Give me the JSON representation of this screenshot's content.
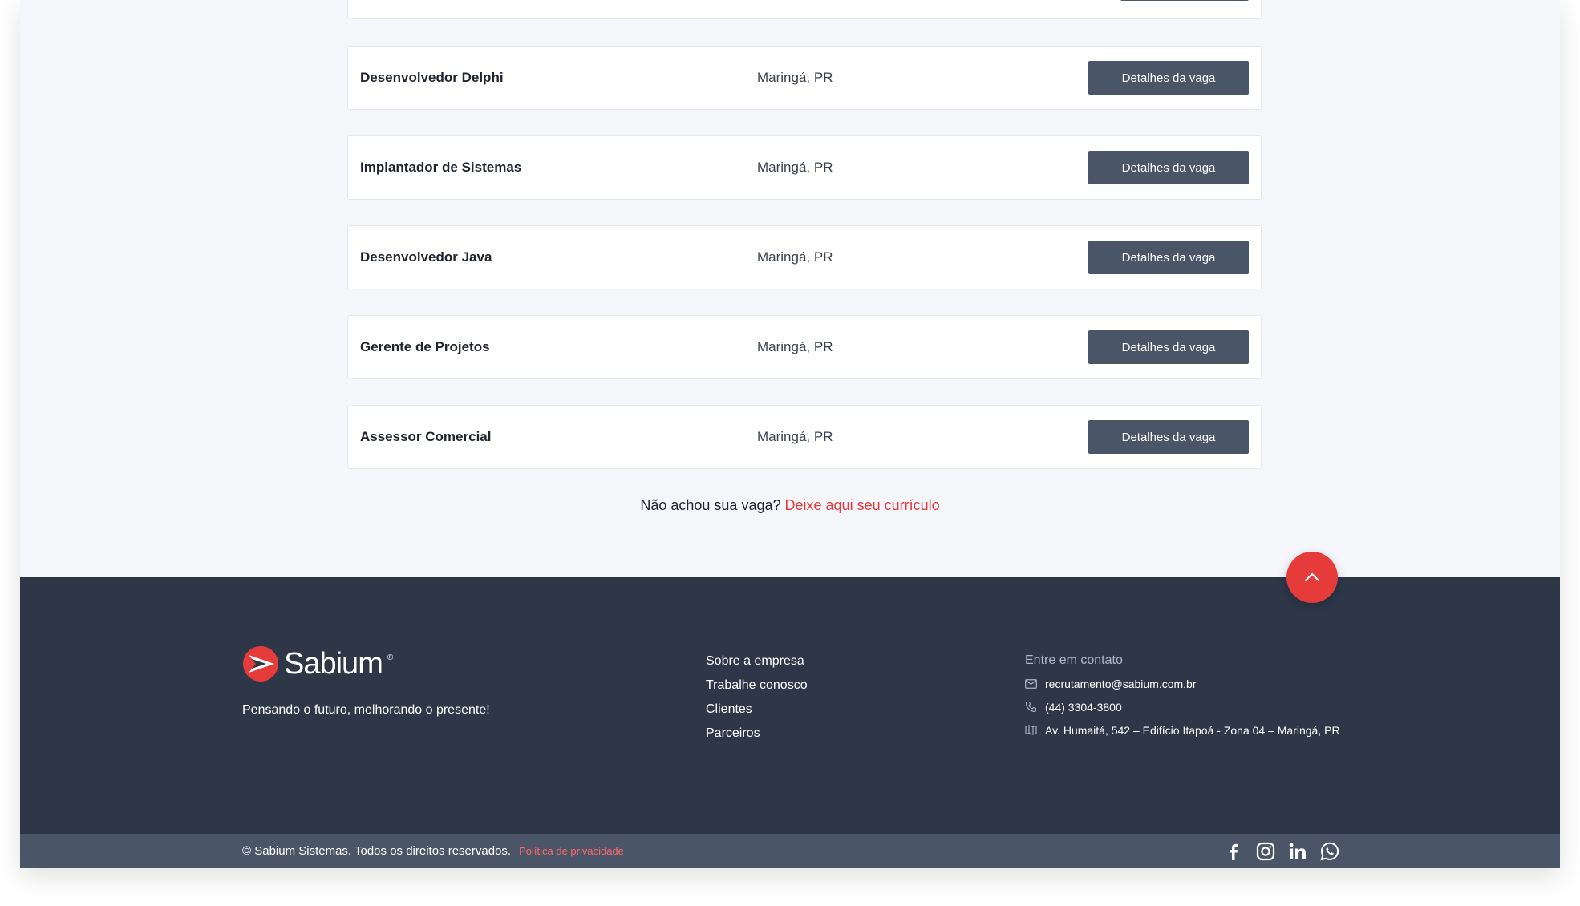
{
  "jobs": [
    {
      "title": "",
      "location": "",
      "button": ""
    },
    {
      "title": "Desenvolvedor Delphi",
      "location": "Maringá, PR",
      "button": "Detalhes da vaga"
    },
    {
      "title": "Implantador de Sistemas",
      "location": "Maringá, PR",
      "button": "Detalhes da vaga"
    },
    {
      "title": "Desenvolvedor Java",
      "location": "Maringá, PR",
      "button": "Detalhes da vaga"
    },
    {
      "title": "Gerente de Projetos",
      "location": "Maringá, PR",
      "button": "Detalhes da vaga"
    },
    {
      "title": "Assessor Comercial",
      "location": "Maringá, PR",
      "button": "Detalhes da vaga"
    }
  ],
  "cv_prompt": {
    "question": "Não achou sua vaga?",
    "link": "Deixe aqui seu currículo"
  },
  "footer": {
    "logo_text": "Sabium",
    "logo_mark": "®",
    "tagline": "Pensando o futuro, melhorando o presente!",
    "links": [
      "Sobre a empresa",
      "Trabalhe conosco",
      "Clientes",
      "Parceiros"
    ],
    "contact": {
      "title": "Entre em contato",
      "email": "recrutamento@sabium.com.br",
      "phone": "(44) 3304-3800",
      "address": "Av. Humaitá, 542 – Edifício Itapoá - Zona 04 – Maringá, PR"
    },
    "copyright": "© Sabium Sistemas. Todos os direitos reservados.",
    "privacy": "Política de privacidade",
    "social": [
      "facebook-icon",
      "instagram-icon",
      "linkedin-icon",
      "whatsapp-icon"
    ]
  },
  "colors": {
    "accent": "#e53b3b",
    "button": "#4b5568",
    "footer": "#2d3748",
    "bottom_bar": "#4b5568"
  }
}
